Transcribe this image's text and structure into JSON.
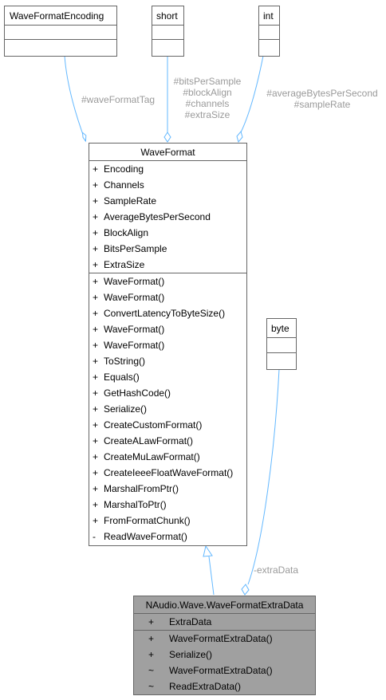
{
  "colors": {
    "edge": "#63b8ff",
    "label": "#9a9a9a",
    "focus_fill": "#a0a0a0",
    "border": "#666666"
  },
  "boxes": {
    "wave_format_encoding": {
      "title": "WaveFormatEncoding"
    },
    "short": {
      "title": "short"
    },
    "int": {
      "title": "int"
    },
    "byte": {
      "title": "byte"
    },
    "wave_format": {
      "title": "WaveFormat",
      "attributes": [
        {
          "vis": "+",
          "name": "Encoding"
        },
        {
          "vis": "+",
          "name": "Channels"
        },
        {
          "vis": "+",
          "name": "SampleRate"
        },
        {
          "vis": "+",
          "name": "AverageBytesPerSecond"
        },
        {
          "vis": "+",
          "name": "BlockAlign"
        },
        {
          "vis": "+",
          "name": "BitsPerSample"
        },
        {
          "vis": "+",
          "name": "ExtraSize"
        }
      ],
      "methods": [
        {
          "vis": "+",
          "name": "WaveFormat()"
        },
        {
          "vis": "+",
          "name": "WaveFormat()"
        },
        {
          "vis": "+",
          "name": "ConvertLatencyToByteSize()"
        },
        {
          "vis": "+",
          "name": "WaveFormat()"
        },
        {
          "vis": "+",
          "name": "WaveFormat()"
        },
        {
          "vis": "+",
          "name": "ToString()"
        },
        {
          "vis": "+",
          "name": "Equals()"
        },
        {
          "vis": "+",
          "name": "GetHashCode()"
        },
        {
          "vis": "+",
          "name": "Serialize()"
        },
        {
          "vis": "+",
          "name": "CreateCustomFormat()"
        },
        {
          "vis": "+",
          "name": "CreateALawFormat()"
        },
        {
          "vis": "+",
          "name": "CreateMuLawFormat()"
        },
        {
          "vis": "+",
          "name": "CreateIeeeFloatWaveFormat()"
        },
        {
          "vis": "+",
          "name": "MarshalFromPtr()"
        },
        {
          "vis": "+",
          "name": "MarshalToPtr()"
        },
        {
          "vis": "+",
          "name": "FromFormatChunk()"
        },
        {
          "vis": "-",
          "name": "ReadWaveFormat()"
        }
      ]
    },
    "extra_data": {
      "title": "NAudio.Wave.WaveFormatExtraData",
      "attributes": [
        {
          "vis": "+",
          "name": "ExtraData"
        }
      ],
      "methods": [
        {
          "vis": "+",
          "name": "WaveFormatExtraData()"
        },
        {
          "vis": "+",
          "name": "Serialize()"
        },
        {
          "vis": "~",
          "name": "WaveFormatExtraData()"
        },
        {
          "vis": "~",
          "name": "ReadExtraData()"
        }
      ]
    }
  },
  "edge_labels": {
    "encoding": "#waveFormatTag",
    "short": [
      "#bitsPerSample",
      "#blockAlign",
      "#channels",
      "#extraSize"
    ],
    "int": [
      "#averageBytesPerSecond",
      "#sampleRate"
    ],
    "byte": "-extraData"
  }
}
